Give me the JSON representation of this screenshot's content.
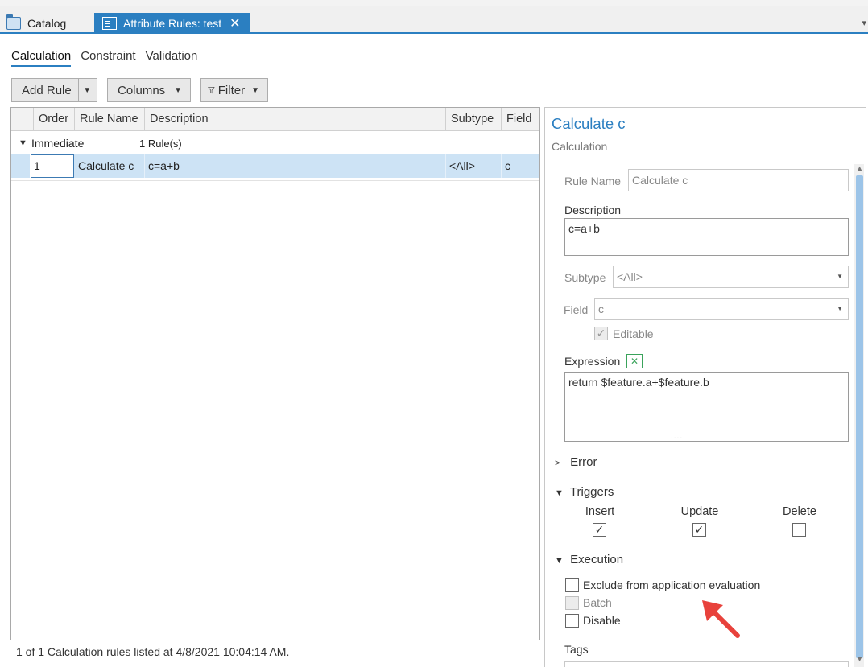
{
  "tabs": {
    "catalog_label": "Catalog",
    "active_label": "Attribute Rules: test",
    "close_glyph": "✕"
  },
  "subtabs": [
    "Calculation",
    "Constraint",
    "Validation"
  ],
  "toolbar": {
    "add_rule": "Add Rule",
    "columns": "Columns",
    "filter": "Filter"
  },
  "grid": {
    "headers": {
      "order": "Order",
      "rule_name": "Rule Name",
      "description": "Description",
      "subtype": "Subtype",
      "field": "Field"
    },
    "group": {
      "name": "Immediate",
      "count": "1 Rule(s)"
    },
    "row": {
      "order": "1",
      "rule_name": "Calculate c",
      "description": "c=a+b",
      "subtype": "<All>",
      "field": "c"
    }
  },
  "status": "1 of 1 Calculation rules listed at 4/8/2021 10:04:14 AM.",
  "panel": {
    "title": "Calculate c",
    "subtitle": "Calculation",
    "rule_name_label": "Rule Name",
    "rule_name_value": "Calculate c",
    "description_label": "Description",
    "description_value": "c=a+b",
    "subtype_label": "Subtype",
    "subtype_value": "<All>",
    "field_label": "Field",
    "field_value": "c",
    "editable_label": "Editable",
    "expression_label": "Expression",
    "expression_value": "return $feature.a+$feature.b",
    "error_label": "Error",
    "triggers_label": "Triggers",
    "triggers": {
      "insert": "Insert",
      "update": "Update",
      "delete": "Delete"
    },
    "execution_label": "Execution",
    "exclude_label": "Exclude from application evaluation",
    "batch_label": "Batch",
    "disable_label": "Disable",
    "tags_label": "Tags"
  },
  "colors": {
    "accent": "#2b7fc1",
    "selected_row": "#cde3f5",
    "annotation_arrow": "#e8423c"
  }
}
